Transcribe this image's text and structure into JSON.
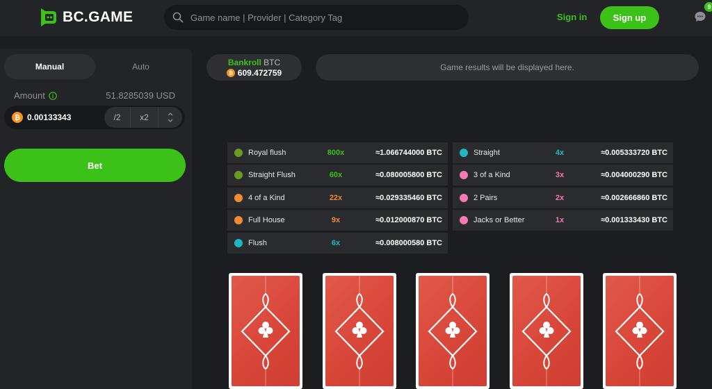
{
  "header": {
    "logo_text": "BC.GAME",
    "search_placeholder": "Game name | Provider | Category Tag",
    "sign_in": "Sign in",
    "sign_up": "Sign up",
    "chat_badge": "9"
  },
  "bet_panel": {
    "tabs": [
      {
        "label": "Manual",
        "active": true
      },
      {
        "label": "Auto",
        "active": false
      }
    ],
    "amount_label": "Amount",
    "amount_usd": "51.8285039 USD",
    "bet_amount": "0.00133343",
    "half_label": "/2",
    "double_label": "x2",
    "bet_button": "Bet"
  },
  "bankroll": {
    "label": "Bankroll",
    "currency": "BTC",
    "value": "609.472759"
  },
  "results_text": "Game results will be displayed here.",
  "paytable": {
    "left": [
      {
        "name": "Royal flush",
        "multiplier": "800x",
        "value": "≈1.066744000 BTC",
        "color": "#6a9a1f",
        "mult_color": "#3bc117"
      },
      {
        "name": "Straight Flush",
        "multiplier": "60x",
        "value": "≈0.080005800 BTC",
        "color": "#6a9a1f",
        "mult_color": "#3bc117"
      },
      {
        "name": "4 of a Kind",
        "multiplier": "22x",
        "value": "≈0.029335460 BTC",
        "color": "#f28a2e",
        "mult_color": "#f28a2e"
      },
      {
        "name": "Full House",
        "multiplier": "9x",
        "value": "≈0.012000870 BTC",
        "color": "#f28a2e",
        "mult_color": "#f28a2e"
      },
      {
        "name": "Flush",
        "multiplier": "6x",
        "value": "≈0.008000580 BTC",
        "color": "#1fb8c2",
        "mult_color": "#1fb8c2"
      }
    ],
    "right": [
      {
        "name": "Straight",
        "multiplier": "4x",
        "value": "≈0.005333720 BTC",
        "color": "#1fb8c2",
        "mult_color": "#1fb8c2"
      },
      {
        "name": "3 of a Kind",
        "multiplier": "3x",
        "value": "≈0.004000290 BTC",
        "color": "#f47ab0",
        "mult_color": "#f47ab0"
      },
      {
        "name": "2 Pairs",
        "multiplier": "2x",
        "value": "≈0.002666860 BTC",
        "color": "#f47ab0",
        "mult_color": "#f47ab0"
      },
      {
        "name": "Jacks or Better",
        "multiplier": "1x",
        "value": "≈0.001333430 BTC",
        "color": "#f47ab0",
        "mult_color": "#f47ab0"
      }
    ]
  },
  "cards": [
    {
      "state": "face-down",
      "suit_icon": "club-icon"
    },
    {
      "state": "face-down",
      "suit_icon": "club-icon"
    },
    {
      "state": "face-down",
      "suit_icon": "club-icon"
    },
    {
      "state": "face-down",
      "suit_icon": "club-icon"
    },
    {
      "state": "face-down",
      "suit_icon": "club-icon"
    }
  ],
  "colors": {
    "accent": "#3bc117",
    "panel": "#232427",
    "background": "#1c1d20",
    "card": "#d9463a",
    "bitcoin": "#f7931a"
  }
}
